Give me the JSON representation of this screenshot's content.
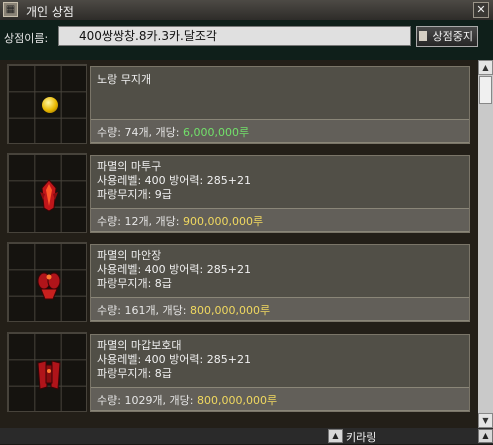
{
  "window": {
    "title": "개인 상점",
    "close_glyph": "✕",
    "icon_glyph": "▦"
  },
  "shop": {
    "name_label": "상점이름:",
    "name_value": "400쌍쌍창.8카.3카.달조각",
    "stop_button": "상점중지"
  },
  "items": [
    {
      "name": "노랑 무지개",
      "stats": [],
      "quantity_text": "수량: 74개, 개당: ",
      "price": "6,000,000루",
      "price_color": "#72e06a",
      "icon": "gold-orb-icon"
    },
    {
      "name": "파멸의 마투구",
      "stats": [
        "사용레벨: 400 방어력: 285+21",
        "파랑무지개: 9급"
      ],
      "quantity_text": "수량: 12개, 개당: ",
      "price": "900,000,000루",
      "price_color": "#f0d860",
      "icon": "helmet-icon"
    },
    {
      "name": "파멸의 마안장",
      "stats": [
        "사용레벨: 400 방어력: 285+21",
        "파랑무지개: 8급"
      ],
      "quantity_text": "수량: 161개, 개당: ",
      "price": "800,000,000루",
      "price_color": "#f0d860",
      "icon": "saddle-icon"
    },
    {
      "name": "파멸의 마갑보호대",
      "stats": [
        "사용레벨: 400 방어력: 285+21",
        "파랑무지개: 8급"
      ],
      "quantity_text": "수량: 1029개, 개당: ",
      "price": "800,000,000루",
      "price_color": "#f0d860",
      "icon": "armor-guard-icon"
    }
  ],
  "scroll": {
    "up": "▲",
    "down": "▼"
  },
  "bottom": {
    "chat_up": "▲",
    "chat_name": "키라링",
    "right_up": "▲"
  }
}
